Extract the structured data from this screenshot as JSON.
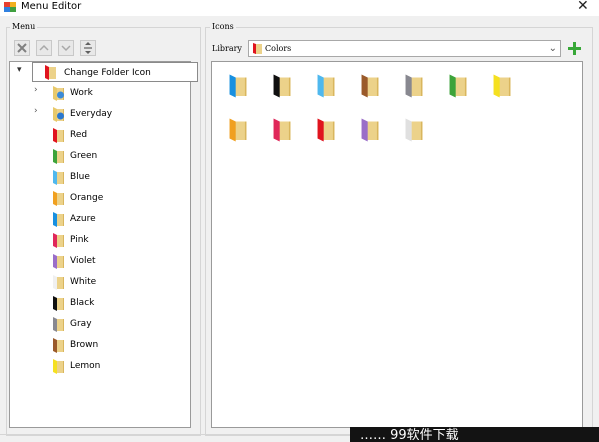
{
  "window": {
    "title": "Menu Editor",
    "close_glyph": "✕"
  },
  "menu_panel": {
    "group_label": "Menu",
    "toolbar": {
      "remove_icon": "x-icon",
      "move_up_icon": "arrow-up-icon",
      "move_down_icon": "arrow-down-icon",
      "sort_icon": "sort-icon"
    },
    "tree": {
      "root": {
        "label": "Change Folder Icon",
        "expanded": true,
        "icon_color": "#e0141e"
      },
      "items": [
        {
          "label": "Work",
          "expandable": true,
          "icon": "gear-icon",
          "color": "#e8c96a"
        },
        {
          "label": "Everyday",
          "expandable": true,
          "icon": "download-icon",
          "color": "#e8c96a"
        },
        {
          "label": "Red",
          "expandable": false,
          "color": "#e0141e"
        },
        {
          "label": "Green",
          "expandable": false,
          "color": "#3da33a"
        },
        {
          "label": "Blue",
          "expandable": false,
          "color": "#4fb8ee"
        },
        {
          "label": "Orange",
          "expandable": false,
          "color": "#f0a020"
        },
        {
          "label": "Azure",
          "expandable": false,
          "color": "#1890e0"
        },
        {
          "label": "Pink",
          "expandable": false,
          "color": "#e0285a"
        },
        {
          "label": "Violet",
          "expandable": false,
          "color": "#9a6ec8"
        },
        {
          "label": "White",
          "expandable": false,
          "color": "#f0f0f0"
        },
        {
          "label": "Black",
          "expandable": false,
          "color": "#101010"
        },
        {
          "label": "Gray",
          "expandable": false,
          "color": "#888890"
        },
        {
          "label": "Brown",
          "expandable": false,
          "color": "#9a5a2a"
        },
        {
          "label": "Lemon",
          "expandable": false,
          "color": "#f5e020"
        }
      ]
    }
  },
  "icons_panel": {
    "group_label": "Icons",
    "library_label": "Library",
    "library_value": "Colors",
    "library_icon_color": "#e0141e",
    "add_icon": "plus-icon",
    "folder_colors": [
      "#1890e0",
      "#101010",
      "#4fb8ee",
      "#9a5a2a",
      "#888890",
      "#3da33a",
      "#f5e020",
      "#f0a020",
      "#e0285a",
      "#e0141e",
      "#9a6ec8",
      "#e0e0e0"
    ]
  },
  "watermark": {
    "text": "…… 99软件下载"
  },
  "colors": {
    "folder_body": "#ecd28a",
    "folder_shade": "#d9b65e"
  }
}
